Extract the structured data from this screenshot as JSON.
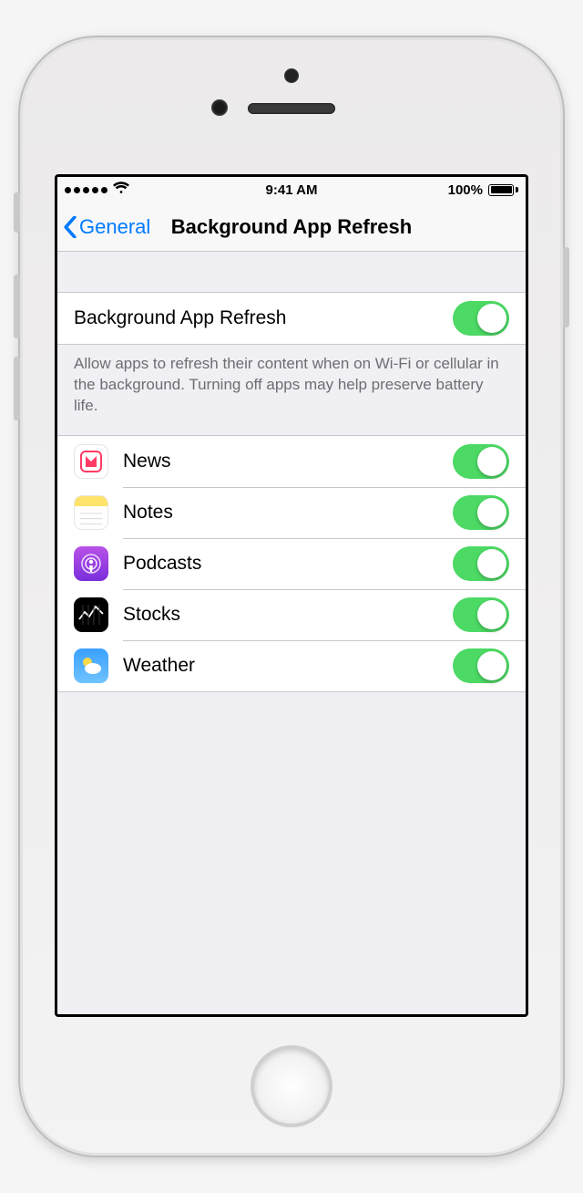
{
  "status": {
    "time": "9:41 AM",
    "battery_pct": "100%"
  },
  "nav": {
    "back_label": "General",
    "title": "Background App Refresh"
  },
  "master": {
    "label": "Background App Refresh",
    "on": true,
    "footer": "Allow apps to refresh their content when on Wi-Fi or cellular in the background. Turning off apps may help preserve battery life."
  },
  "apps": [
    {
      "id": "news",
      "label": "News",
      "on": true,
      "icon": "news-icon"
    },
    {
      "id": "notes",
      "label": "Notes",
      "on": true,
      "icon": "notes-icon"
    },
    {
      "id": "podcasts",
      "label": "Podcasts",
      "on": true,
      "icon": "podcasts-icon"
    },
    {
      "id": "stocks",
      "label": "Stocks",
      "on": true,
      "icon": "stocks-icon"
    },
    {
      "id": "weather",
      "label": "Weather",
      "on": true,
      "icon": "weather-icon"
    }
  ]
}
